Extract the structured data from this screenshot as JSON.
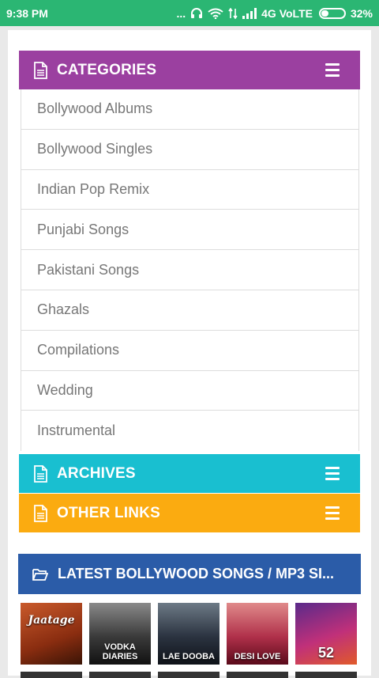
{
  "status_bar": {
    "time": "9:38 PM",
    "dots": "...",
    "network": "4G VoLTE",
    "battery": "32%"
  },
  "categories": {
    "title": "CATEGORIES",
    "color": "#9b40a0",
    "items": [
      {
        "label": "Bollywood Albums"
      },
      {
        "label": "Bollywood Singles"
      },
      {
        "label": "Indian Pop Remix"
      },
      {
        "label": "Punjabi Songs"
      },
      {
        "label": "Pakistani Songs"
      },
      {
        "label": "Ghazals"
      },
      {
        "label": "Compilations"
      },
      {
        "label": "Wedding"
      },
      {
        "label": "Instrumental"
      }
    ]
  },
  "archives": {
    "title": "ARCHIVES",
    "color": "#19bfd0"
  },
  "other_links": {
    "title": "OTHER LINKS",
    "color": "#fbab10"
  },
  "latest": {
    "title": "LATEST BOLLYWOOD SONGS / MP3 SI...",
    "color": "#2b5ca8",
    "thumbnails": [
      {
        "caption": "Jaatage"
      },
      {
        "caption": "VODKA DIARIES"
      },
      {
        "caption": "LAE DOOBA"
      },
      {
        "caption": "DESI LOVE"
      },
      {
        "caption": "52"
      }
    ]
  },
  "icons": {
    "header": "document-icon",
    "menu": "hamburger-menu-icon",
    "latest": "folder-open-icon"
  }
}
